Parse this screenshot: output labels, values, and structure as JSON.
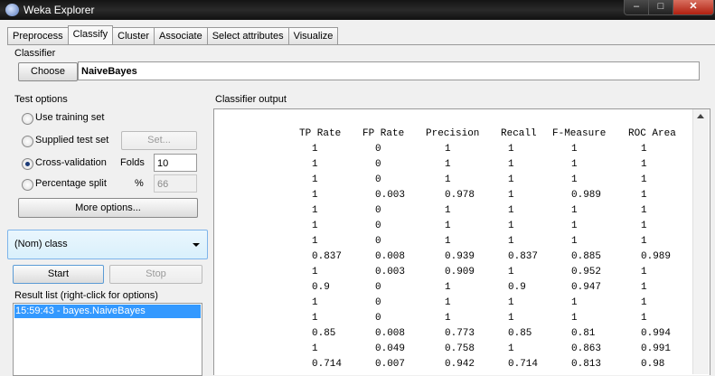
{
  "window": {
    "title": "Weka Explorer",
    "minimize": "–",
    "maximize": "□",
    "close": "✕"
  },
  "tabs": [
    "Preprocess",
    "Classify",
    "Cluster",
    "Associate",
    "Select attributes",
    "Visualize"
  ],
  "active_tab": "Classify",
  "classifier": {
    "group_label": "Classifier",
    "choose_label": "Choose",
    "name": "NaiveBayes"
  },
  "test_options": {
    "group_label": "Test options",
    "options": [
      "Use training set",
      "Supplied test set",
      "Cross-validation",
      "Percentage split"
    ],
    "selected": "Cross-validation",
    "set_label": "Set...",
    "folds_label": "Folds",
    "folds_value": "10",
    "percent_label": "%",
    "percent_value": "66",
    "more_options_label": "More options..."
  },
  "class_select": {
    "value": "(Nom) class"
  },
  "actions": {
    "start_label": "Start",
    "stop_label": "Stop"
  },
  "result_list": {
    "label": "Result list (right-click for options)",
    "items": [
      "15:59:43 - bayes.NaiveBayes"
    ]
  },
  "output": {
    "label": "Classifier output",
    "headers": [
      "TP Rate",
      "FP Rate",
      "Precision",
      "Recall",
      "F-Measure",
      "ROC Area"
    ],
    "rows": [
      [
        "1",
        "0",
        "1",
        "1",
        "1",
        "1"
      ],
      [
        "1",
        "0",
        "1",
        "1",
        "1",
        "1"
      ],
      [
        "1",
        "0",
        "1",
        "1",
        "1",
        "1"
      ],
      [
        "1",
        "0.003",
        "0.978",
        "1",
        "0.989",
        "1"
      ],
      [
        "1",
        "0",
        "1",
        "1",
        "1",
        "1"
      ],
      [
        "1",
        "0",
        "1",
        "1",
        "1",
        "1"
      ],
      [
        "1",
        "0",
        "1",
        "1",
        "1",
        "1"
      ],
      [
        "0.837",
        "0.008",
        "0.939",
        "0.837",
        "0.885",
        "0.989"
      ],
      [
        "1",
        "0.003",
        "0.909",
        "1",
        "0.952",
        "1"
      ],
      [
        "0.9",
        "0",
        "1",
        "0.9",
        "0.947",
        "1"
      ],
      [
        "1",
        "0",
        "1",
        "1",
        "1",
        "1"
      ],
      [
        "1",
        "0",
        "1",
        "1",
        "1",
        "1"
      ],
      [
        "0.85",
        "0.008",
        "0.773",
        "0.85",
        "0.81",
        "0.994"
      ],
      [
        "1",
        "0.049",
        "0.758",
        "1",
        "0.863",
        "0.991"
      ],
      [
        "0.714",
        "0.007",
        "0.942",
        "0.714",
        "0.813",
        "0.98"
      ]
    ]
  }
}
